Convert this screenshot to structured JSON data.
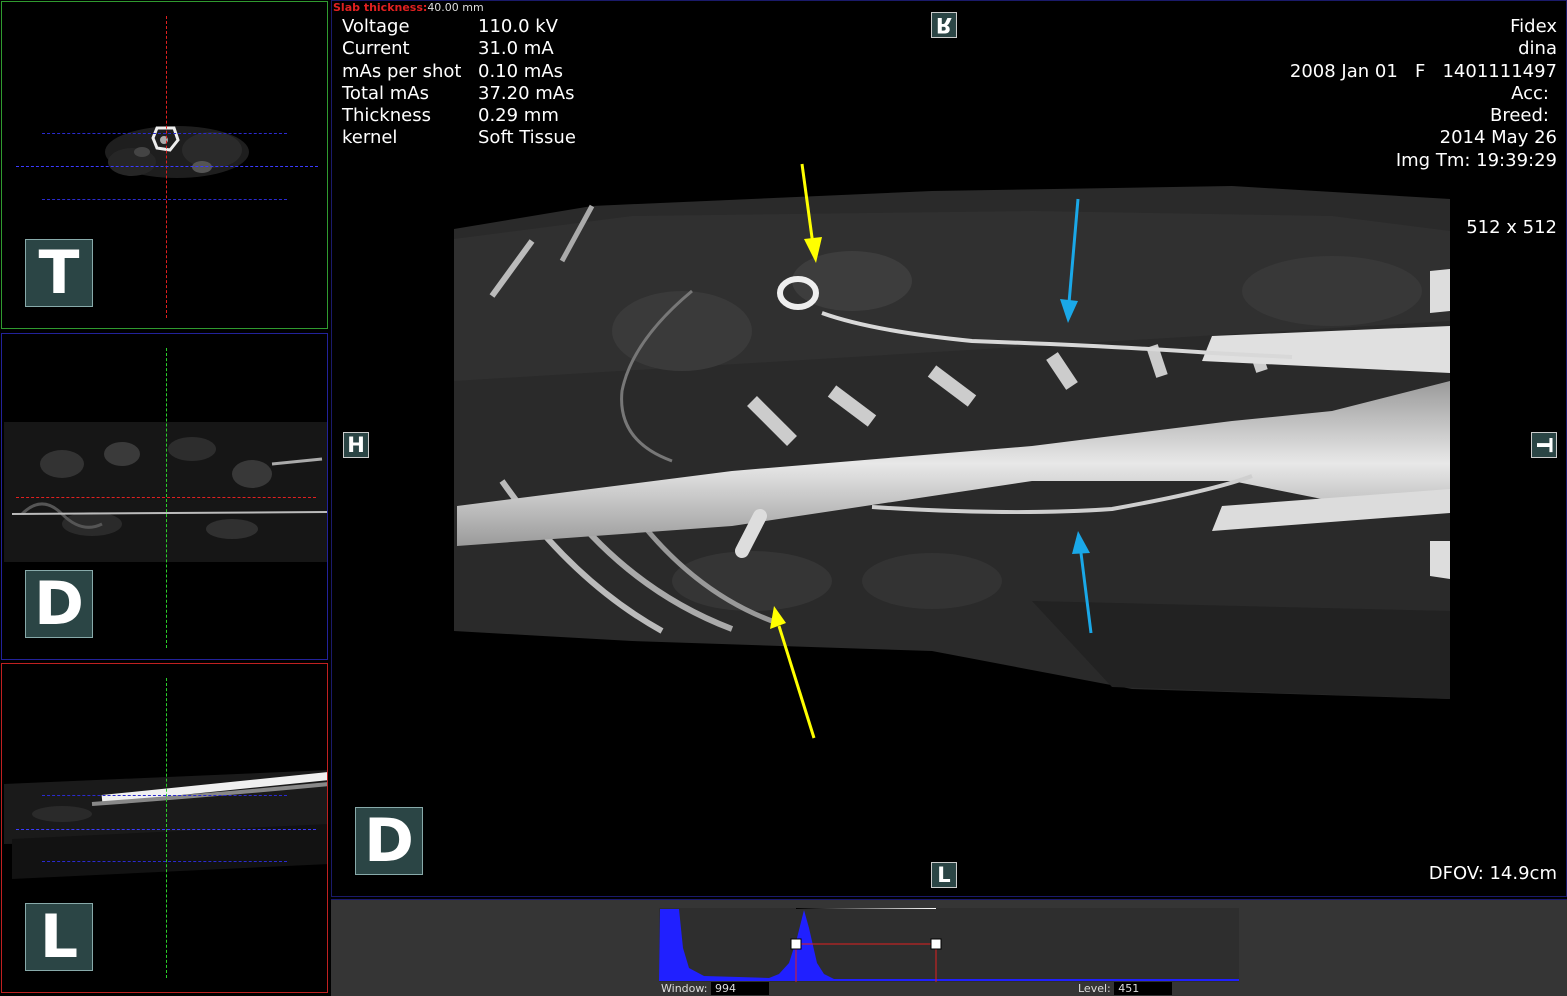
{
  "views": {
    "transverse": {
      "orientation_label": "T"
    },
    "dorsal": {
      "orientation_label": "D"
    },
    "lateral": {
      "orientation_label": "L"
    }
  },
  "main": {
    "slab_thickness_label": "Slab thickness:",
    "slab_thickness_value": "40.00 mm",
    "acquisition": [
      {
        "label": "Voltage",
        "value": "110.0 kV"
      },
      {
        "label": "Current",
        "value": "31.0 mA"
      },
      {
        "label": "mAs per shot",
        "value": "0.10 mAs"
      },
      {
        "label": "Total mAs",
        "value": "37.20 mAs"
      },
      {
        "label": "Thickness",
        "value": "0.29 mm"
      },
      {
        "label": "kernel",
        "value": "Soft Tissue"
      }
    ],
    "patient": {
      "device": "Fidex",
      "name": "dina",
      "dob_sex_id": "2008 Jan 01   F   1401111497",
      "acc": "Acc:",
      "breed": "Breed:",
      "study_date": "2014 May 26",
      "img_time": "Img Tm: 19:39:29"
    },
    "matrix": "512 x 512",
    "dfov": "DFOV: 14.9cm",
    "orientation_markers": {
      "top": "R",
      "bottom": "L",
      "left": "H",
      "right": "T",
      "view": "D"
    },
    "arrow_colors": {
      "yellow": "#ffff00",
      "blue": "#1aa8e8"
    }
  },
  "histogram": {
    "window_label": "Window:",
    "window_value": "994",
    "level_label": "Level:",
    "level_value": "451",
    "fill_color": "#2020ff"
  }
}
